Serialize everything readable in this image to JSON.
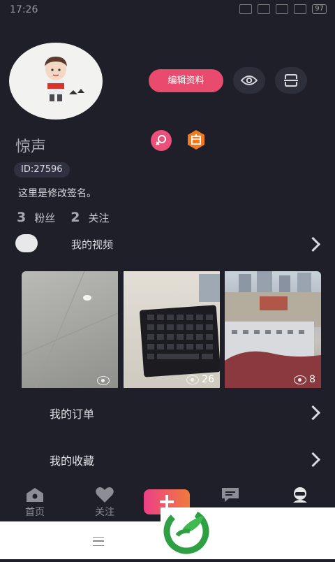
{
  "status_bar": {
    "time": "17:26",
    "battery": "97"
  },
  "profile": {
    "edit_button": "编辑资料",
    "username": "惊声",
    "id_tag": "ID:27596",
    "signature": "这里是修改签名。",
    "stats": {
      "fans_count": "3",
      "fans_label": "粉丝",
      "following_count": "2",
      "following_label": "关注"
    },
    "badges": {
      "gender": "female-icon",
      "shop": "shop-icon"
    }
  },
  "my_videos": {
    "label": "我的视频",
    "thumbnails": [
      {
        "views": ""
      },
      {
        "views": "26"
      },
      {
        "views": "8"
      }
    ]
  },
  "menu_rows": {
    "orders": "我的订单",
    "favorites": "我的收藏"
  },
  "bottom_nav": {
    "home": "首页",
    "follow": "关注",
    "add": "+",
    "messages": "",
    "me": ""
  },
  "colors": {
    "background": "#1e1f28",
    "accent_pink": "#e94b6e",
    "plus_gradient_start": "#ec3f88",
    "plus_gradient_end": "#f07a3c",
    "logo_green": "#2ea043"
  }
}
